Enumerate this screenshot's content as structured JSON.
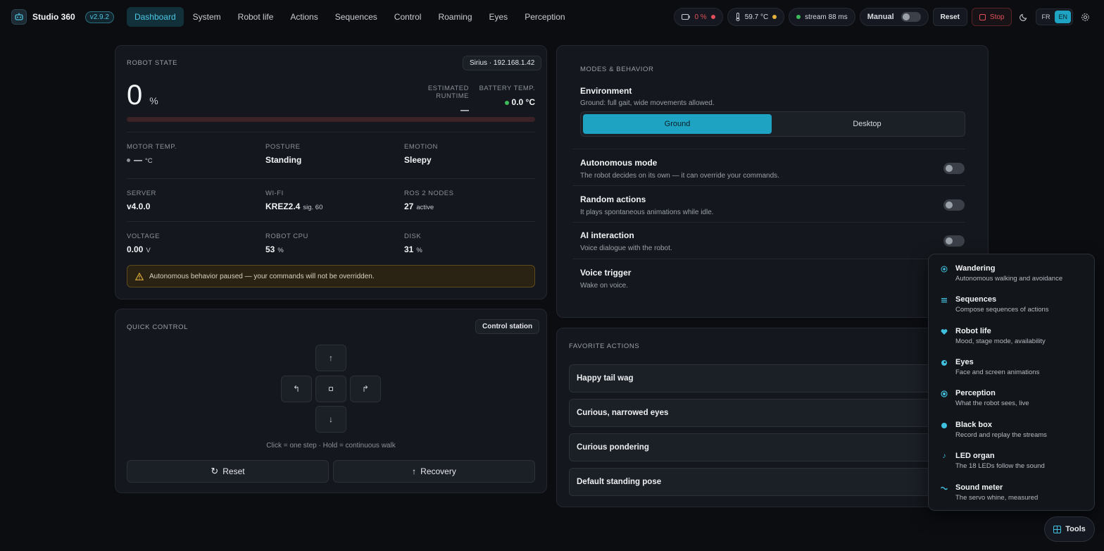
{
  "app": {
    "name": "Studio 360",
    "version": "v2.9.2"
  },
  "nav": [
    {
      "label": "Dashboard",
      "active": true
    },
    {
      "label": "System"
    },
    {
      "label": "Robot life"
    },
    {
      "label": "Actions"
    },
    {
      "label": "Sequences"
    },
    {
      "label": "Control"
    },
    {
      "label": "Roaming"
    },
    {
      "label": "Eyes"
    },
    {
      "label": "Perception"
    }
  ],
  "status": {
    "battery": "0 %",
    "temperature": "59.7 °C",
    "stream": "stream 88 ms",
    "mode_label": "Manual",
    "reset_label": "Reset",
    "stop_label": "Stop",
    "lang_fr": "FR",
    "lang_en": "EN"
  },
  "colors": {
    "accent": "#1fa3c2",
    "danger": "#e0505a",
    "ok": "#3dbb5a",
    "warn": "#e0b03a"
  },
  "robot_state": {
    "title": "ROBOT STATE",
    "robot_chip": "Sirius · 192.168.1.42",
    "battery_value": "0",
    "battery_unit": "%",
    "battery_level_percent": 0,
    "runtime_label": "ESTIMATED RUNTIME",
    "runtime_value": "—",
    "battery_temp_label": "BATTERY TEMP.",
    "battery_temp_value": "0.0 °C",
    "metrics": [
      [
        {
          "label": "MOTOR TEMP.",
          "value": "—",
          "unit": "°C"
        },
        {
          "label": "POSTURE",
          "value": "Standing",
          "unit": ""
        },
        {
          "label": "EMOTION",
          "value": "Sleepy",
          "unit": ""
        }
      ],
      [
        {
          "label": "SERVER",
          "value": "v4.0.0",
          "unit": ""
        },
        {
          "label": "WI-FI",
          "value": "KREZ2.4",
          "unit": "sig. 60"
        },
        {
          "label": "ROS 2 NODES",
          "value": "27",
          "unit": "active"
        }
      ],
      [
        {
          "label": "VOLTAGE",
          "value": "0.00",
          "unit": "V"
        },
        {
          "label": "ROBOT CPU",
          "value": "53",
          "unit": "%"
        },
        {
          "label": "DISK",
          "value": "31",
          "unit": "%"
        }
      ]
    ],
    "alert": "Autonomous behavior paused — your commands will not be overridden."
  },
  "quick_control": {
    "title": "QUICK CONTROL",
    "station_label": "Control station",
    "hint": "Click = one step · Hold = continuous walk",
    "reset_label": "Reset",
    "recovery_label": "Recovery"
  },
  "modes": {
    "title": "MODES & BEHAVIOR",
    "environment_title": "Environment",
    "environment_desc": "Ground: full gait, wide movements allowed.",
    "env_options": [
      "Ground",
      "Desktop"
    ],
    "rows": [
      {
        "title": "Autonomous mode",
        "desc": "The robot decides on its own — it can override your commands."
      },
      {
        "title": "Random actions",
        "desc": "It plays spontaneous animations while idle."
      },
      {
        "title": "AI interaction",
        "desc": "Voice dialogue with the robot."
      },
      {
        "title": "Voice trigger",
        "desc": "Wake on voice."
      }
    ]
  },
  "favorites": {
    "title": "FAVORITE ACTIONS",
    "items": [
      "Happy tail wag",
      "Curious, narrowed eyes",
      "Curious pondering",
      "Default standing pose"
    ]
  },
  "tools": {
    "button_label": "Tools",
    "items": [
      {
        "title": "Wandering",
        "desc": "Autonomous walking and avoidance",
        "icon": "target-icon"
      },
      {
        "title": "Sequences",
        "desc": "Compose sequences of actions",
        "icon": "list-icon"
      },
      {
        "title": "Robot life",
        "desc": "Mood, stage mode, availability",
        "icon": "heart-icon"
      },
      {
        "title": "Eyes",
        "desc": "Face and screen animations",
        "icon": "eye-icon"
      },
      {
        "title": "Perception",
        "desc": "What the robot sees, live",
        "icon": "radar-icon"
      },
      {
        "title": "Black box",
        "desc": "Record and replay the streams",
        "icon": "record-icon"
      },
      {
        "title": "LED organ",
        "desc": "The 18 LEDs follow the sound",
        "icon": "music-note-icon"
      },
      {
        "title": "Sound meter",
        "desc": "The servo whine, measured",
        "icon": "wave-icon"
      }
    ]
  }
}
